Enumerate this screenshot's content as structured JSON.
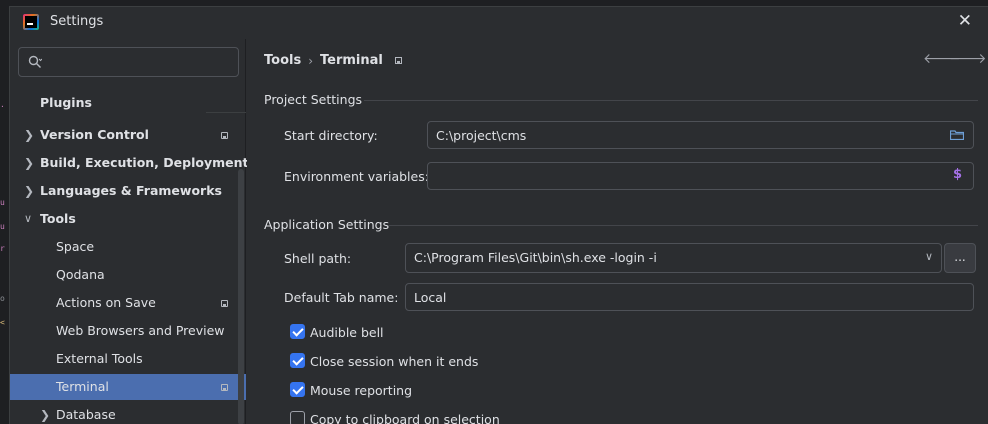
{
  "window": {
    "title": "Settings"
  },
  "search": {
    "placeholder": "",
    "value": ""
  },
  "sidebar": {
    "items": [
      {
        "label": "Plugins",
        "level": 0,
        "expandable": false,
        "bold": true
      },
      {
        "label": "Version Control",
        "level": 0,
        "expandable": true,
        "expanded": false,
        "bold": true,
        "badge": true
      },
      {
        "label": "Build, Execution, Deployment",
        "level": 0,
        "expandable": true,
        "expanded": false,
        "bold": true
      },
      {
        "label": "Languages & Frameworks",
        "level": 0,
        "expandable": true,
        "expanded": false,
        "bold": true
      },
      {
        "label": "Tools",
        "level": 0,
        "expandable": true,
        "expanded": true,
        "bold": true
      },
      {
        "label": "Space",
        "level": 1
      },
      {
        "label": "Qodana",
        "level": 1
      },
      {
        "label": "Actions on Save",
        "level": 1,
        "badge": true
      },
      {
        "label": "Web Browsers and Preview",
        "level": 1
      },
      {
        "label": "External Tools",
        "level": 1
      },
      {
        "label": "Terminal",
        "level": 1,
        "selected": true,
        "badge": true
      },
      {
        "label": "Database",
        "level": 1,
        "expandable": true,
        "expanded": false
      }
    ]
  },
  "breadcrumb": {
    "parent": "Tools",
    "separator": "›",
    "current": "Terminal"
  },
  "project_settings": {
    "title": "Project Settings",
    "start_directory": {
      "label": "Start directory:",
      "value": "C:\\project\\cms"
    },
    "environment_variables": {
      "label": "Environment variables:",
      "value": ""
    }
  },
  "application_settings": {
    "title": "Application Settings",
    "shell_path": {
      "label": "Shell path:",
      "value": "C:\\Program Files\\Git\\bin\\sh.exe -login -i",
      "browse_label": "..."
    },
    "default_tab_name": {
      "label": "Default Tab name:",
      "value": "Local"
    },
    "checkboxes": [
      {
        "label": "Audible bell",
        "checked": true
      },
      {
        "label": "Close session when it ends",
        "checked": true
      },
      {
        "label": "Mouse reporting",
        "checked": true
      },
      {
        "label": "Copy to clipboard on selection",
        "checked": false
      }
    ]
  },
  "colors": {
    "dialog_bg": "#2b2d30",
    "selected_bg": "#4b6eaf",
    "checkbox_on": "#3574f0",
    "dollar_accent": "#a571e6",
    "folder_icon": "#6e9fd6"
  }
}
